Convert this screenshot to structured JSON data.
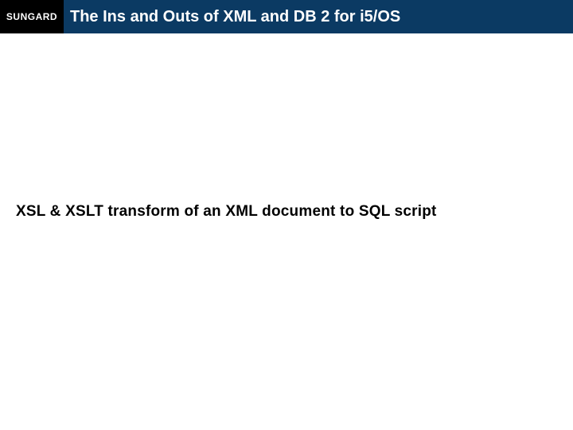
{
  "logo": "SUNGARD",
  "title": "The Ins and Outs of XML and DB 2 for i5/OS",
  "body": "XSL & XSLT transform of an XML document to SQL script"
}
